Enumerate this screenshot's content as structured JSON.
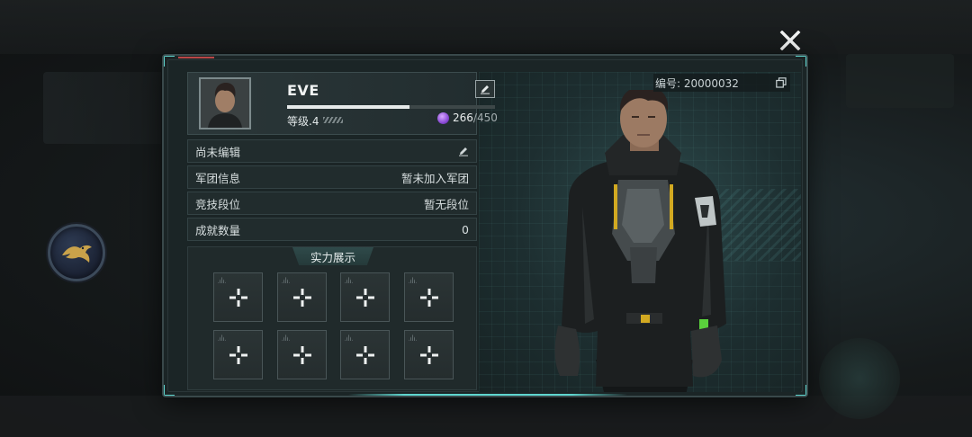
{
  "close": {
    "icon": "close-x-icon"
  },
  "side_emblem": {
    "icon": "bird-emblem-icon"
  },
  "profile": {
    "name": "EVE",
    "level_text": "等级.4",
    "xp_progress": 0.59,
    "energy_current": "266",
    "energy_max": "/450",
    "edit_icon": "pencil-icon",
    "energy_icon": "purple-orb-icon"
  },
  "player_id": {
    "text": "编号: 20000032",
    "copy_icon": "copy-icon"
  },
  "info_rows": [
    {
      "label": "尚未编辑",
      "value": "",
      "icon": "pencil-icon"
    },
    {
      "label": "军团信息",
      "value": "暂未加入军团"
    },
    {
      "label": "竞技段位",
      "value": "暂无段位"
    },
    {
      "label": "成就数量",
      "value": "0"
    }
  ],
  "showcase": {
    "title": "实力展示",
    "slot_count": 8,
    "slot_icon": "plus-icon"
  },
  "colors": {
    "accent": "#5fd6cf",
    "panel": "#1b2526",
    "energy": "#8b4bd6"
  }
}
